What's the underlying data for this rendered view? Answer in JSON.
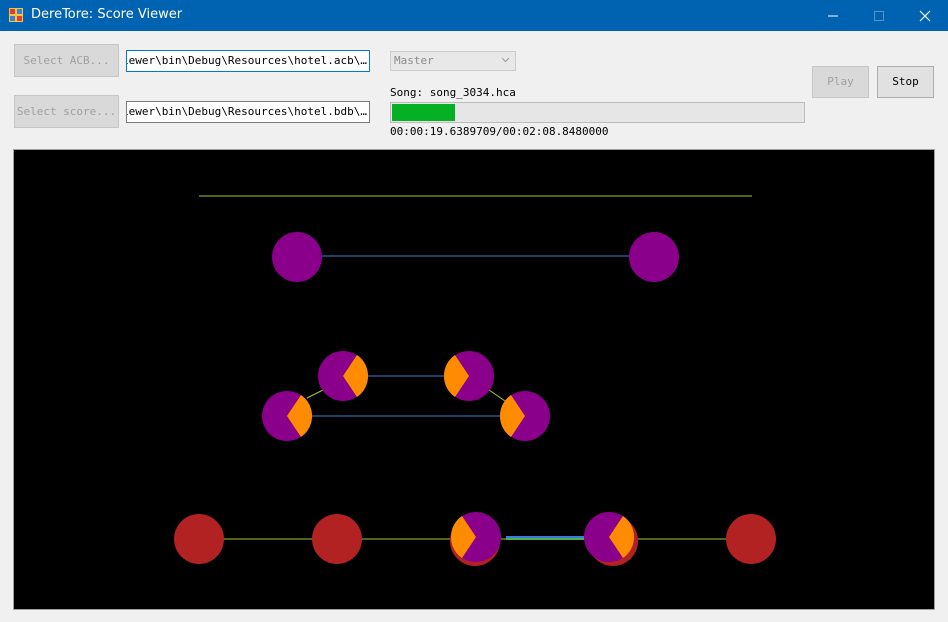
{
  "window": {
    "title": "DereTore: Score Viewer",
    "controls": [
      "minimize-icon",
      "maximize-icon",
      "close-icon"
    ]
  },
  "toolbar": {
    "select_acb_label": "Select ACB...",
    "select_score_label": "Select score...",
    "acb_path": "…\\ScoreViewer\\bin\\Debug\\Resources\\hotel.acb",
    "score_path": "…\\ScoreViewer\\bin\\Debug\\Resources\\hotel.bdb",
    "difficulty": "Master",
    "play_label": "Play",
    "stop_label": "Stop"
  },
  "playback": {
    "song_label": "Song: song_3034.hca",
    "time_label": "00:00:19.6389709/00:02:08.8480000",
    "progress": 0.153
  },
  "colors": {
    "titlebar": "#0063b1",
    "note_slide": "#8b008b",
    "note_flick_arrow": "#ff8c00",
    "note_tap": "#b22222",
    "hold_line": "#3b7ddd",
    "sync_line": "#9acd32",
    "progress": "#06b025"
  }
}
